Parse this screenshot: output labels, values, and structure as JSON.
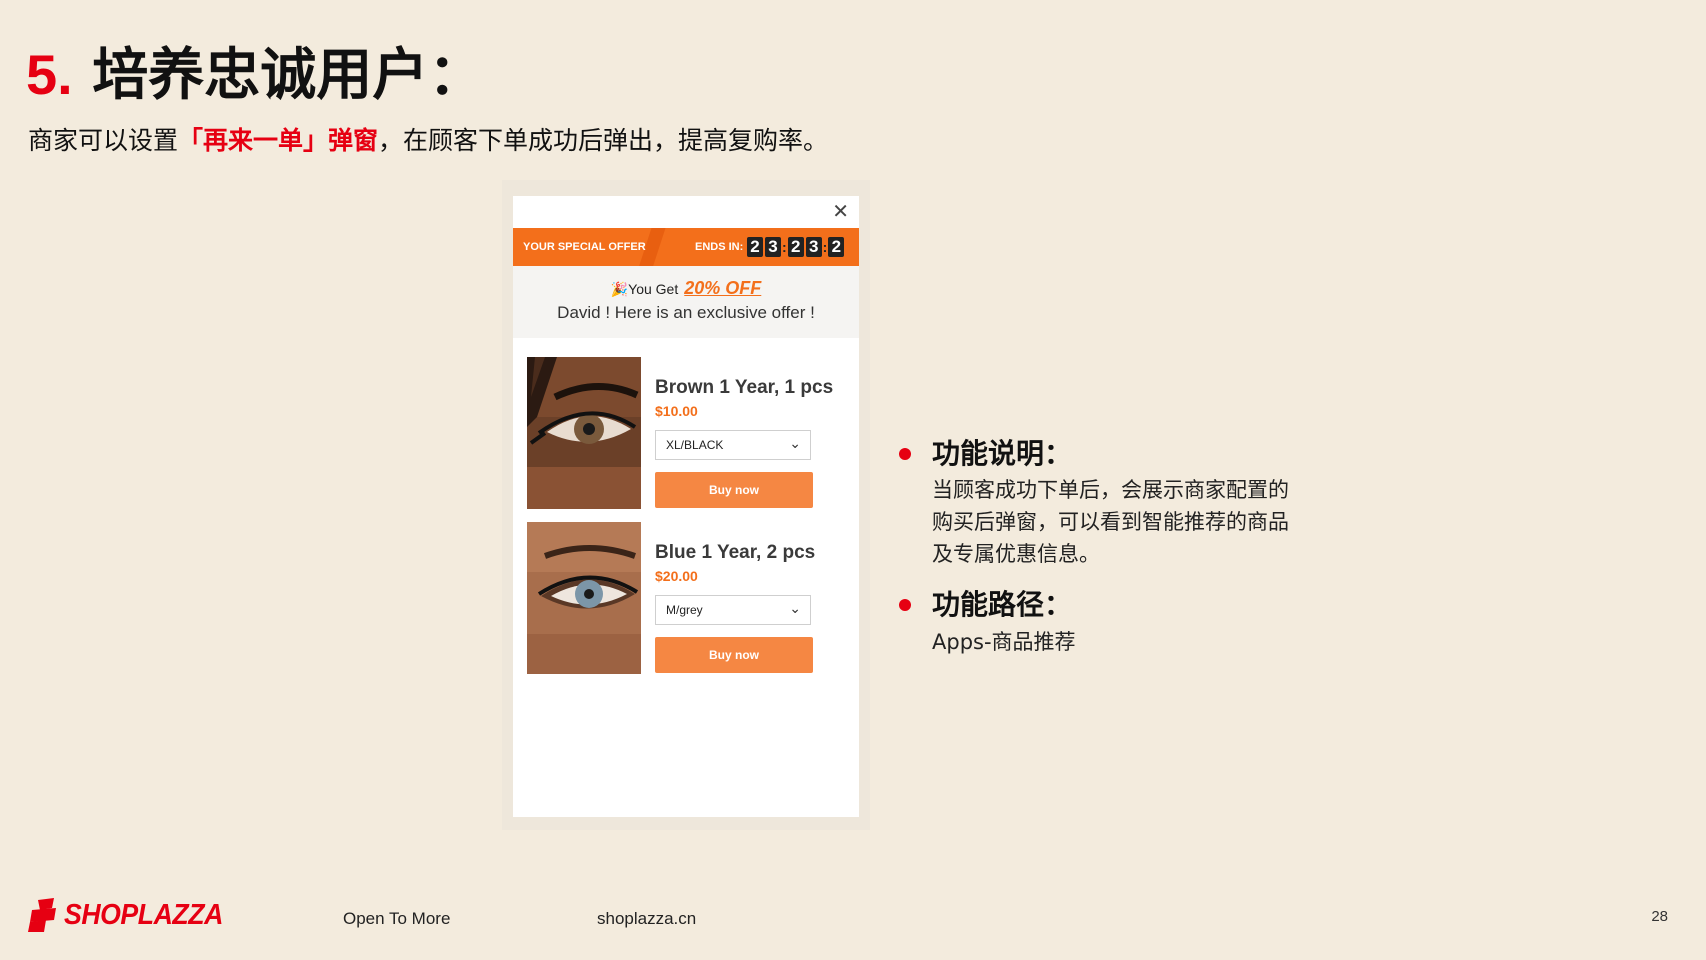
{
  "slide": {
    "number": "5.",
    "title": "培养忠诚用户：",
    "subtitle_before": "商家可以设置",
    "subtitle_highlight": "「再来一单」弹窗",
    "subtitle_after": "，在顾客下单成功后弹出，提高复购率。"
  },
  "popup": {
    "close_glyph": "✕",
    "offer_label": "YOUR SPECIAL OFFER",
    "ends_label": "ENDS IN:",
    "timer_digits": [
      "2",
      "3",
      "2",
      "3",
      "2"
    ],
    "timer_sep": ":",
    "greet_emoji": "🎉",
    "greet_prefix": "You Get",
    "greet_discount": "20% OFF",
    "greet_line2": "David ! Here is an exclusive offer !",
    "products": [
      {
        "name": "Brown 1 Year, 1 pcs",
        "price": "$10.00",
        "variant": "XL/BLACK",
        "buy_label": "Buy now",
        "eye_color": "#7a5a3c"
      },
      {
        "name": "Blue 1 Year, 2 pcs",
        "price": "$20.00",
        "variant": "M/grey",
        "buy_label": "Buy now",
        "eye_color": "#7c96a8"
      }
    ]
  },
  "features": [
    {
      "title": "功能说明：",
      "body_lines": [
        "当顾客成功下单后，会展示商家配置的",
        "购买后弹窗，可以看到智能推荐的商品",
        "及专属优惠信息。"
      ]
    },
    {
      "title": "功能路径：",
      "body_lines": [
        "Apps-商品推荐"
      ]
    }
  ],
  "footer": {
    "brand": "SHOPLAZZA",
    "slogan": "Open To More",
    "site": "shoplazza.cn",
    "page": "28"
  },
  "colors": {
    "brand_red": "#e60012",
    "offer_orange": "#f36f1b",
    "background": "#f3ebdd"
  }
}
